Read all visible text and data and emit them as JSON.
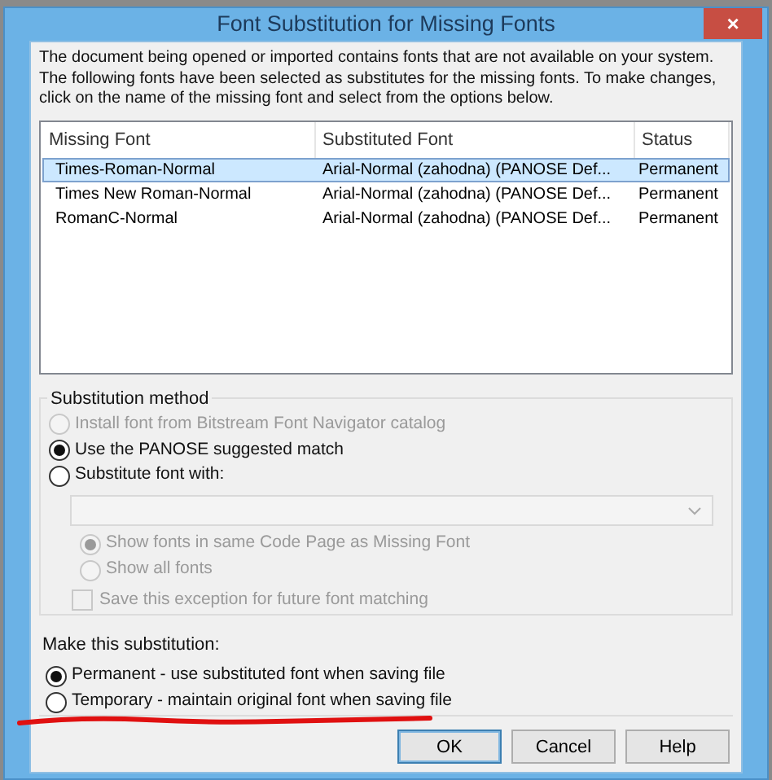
{
  "window": {
    "title": "Font Substitution for Missing Fonts",
    "close": "×"
  },
  "intro": "The document being opened or imported contains fonts that are not available on your system.  The following fonts have been selected as substitutes for the missing fonts.  To make changes, click on the name of the missing font and select from the options below.",
  "table": {
    "columns": [
      "Missing Font",
      "Substituted Font",
      "Status"
    ],
    "rows": [
      {
        "cells": [
          "Times-Roman-Normal",
          "Arial-Normal (zahodna) (PANOSE Def...",
          "Permanent"
        ],
        "selected": true
      },
      {
        "cells": [
          "Times New Roman-Normal",
          "Arial-Normal (zahodna) (PANOSE Def...",
          "Permanent"
        ],
        "selected": false
      },
      {
        "cells": [
          "RomanC-Normal",
          "Arial-Normal (zahodna) (PANOSE Def...",
          "Permanent"
        ],
        "selected": false
      }
    ]
  },
  "method": {
    "title": "Substitution method",
    "options": [
      {
        "label": "Install font from Bitstream Font Navigator catalog",
        "selected": false,
        "disabled": true
      },
      {
        "label": "Use the PANOSE suggested match",
        "selected": true,
        "disabled": false
      },
      {
        "label": "Substitute font with:",
        "selected": false,
        "disabled": false
      }
    ],
    "font_select": {
      "disabled": true
    },
    "code_page_options": [
      {
        "label": "Show fonts in same Code Page as Missing Font",
        "selected": true,
        "disabled": true
      },
      {
        "label": "Show all fonts",
        "selected": false,
        "disabled": true
      }
    ],
    "save_exception": {
      "label": "Save this exception for future font matching",
      "checked": false,
      "disabled": true
    }
  },
  "substitution": {
    "title": "Make this substitution:",
    "options": [
      {
        "label": "Permanent - use substituted font when saving file",
        "selected": true
      },
      {
        "label": "Temporary - maintain original font when saving file",
        "selected": false
      }
    ]
  },
  "buttons": [
    {
      "label": "OK",
      "default": true
    },
    {
      "label": "Cancel",
      "default": false
    },
    {
      "label": "Help",
      "default": false
    }
  ]
}
